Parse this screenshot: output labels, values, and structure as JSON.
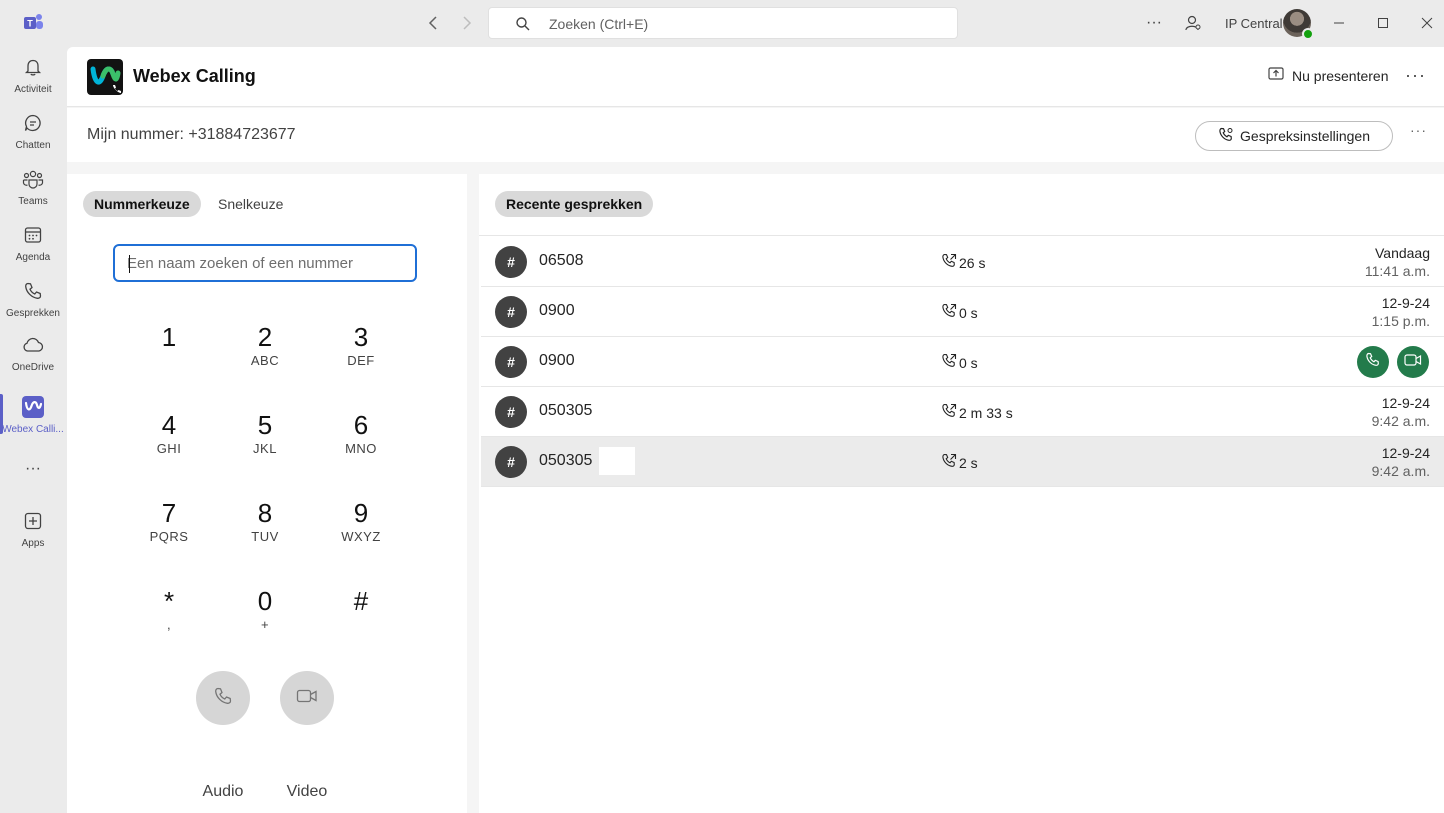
{
  "titlebar": {
    "search_placeholder": "Zoeken (Ctrl+E)",
    "org_name": "IP Central",
    "more": "···"
  },
  "rail": {
    "items": [
      {
        "label": "Activiteit",
        "icon": "bell-icon"
      },
      {
        "label": "Chatten",
        "icon": "chat-icon"
      },
      {
        "label": "Teams",
        "icon": "teams-icon"
      },
      {
        "label": "Agenda",
        "icon": "calendar-icon"
      },
      {
        "label": "Gesprekken",
        "icon": "phone-icon"
      },
      {
        "label": "OneDrive",
        "icon": "cloud-icon"
      },
      {
        "label": "Webex Calli...",
        "icon": "webex-icon",
        "active": true
      },
      {
        "label": "Apps",
        "icon": "add-app-icon"
      }
    ],
    "more": "···"
  },
  "app": {
    "title": "Webex Calling",
    "present_label": "Nu presenteren",
    "more": "···"
  },
  "subbar": {
    "my_number": "Mijn nummer: +31884723677",
    "settings_label": "Gespreksinstellingen",
    "more": "···"
  },
  "dialer": {
    "tabs": [
      "Nummerkeuze",
      "Snelkeuze"
    ],
    "selected_tab": "Nummerkeuze",
    "input_placeholder": "Een naam zoeken of een nummer",
    "keys": [
      {
        "digit": "1",
        "letters": ""
      },
      {
        "digit": "2",
        "letters": "ABC"
      },
      {
        "digit": "3",
        "letters": "DEF"
      },
      {
        "digit": "4",
        "letters": "GHI"
      },
      {
        "digit": "5",
        "letters": "JKL"
      },
      {
        "digit": "6",
        "letters": "MNO"
      },
      {
        "digit": "7",
        "letters": "PQRS"
      },
      {
        "digit": "8",
        "letters": "TUV"
      },
      {
        "digit": "9",
        "letters": "WXYZ"
      },
      {
        "digit": "*",
        "letters": ","
      },
      {
        "digit": "0",
        "letters": "+"
      },
      {
        "digit": "#",
        "letters": ""
      }
    ],
    "audio_label": "Audio",
    "video_label": "Video"
  },
  "recent": {
    "tab_label": "Recente gesprekken",
    "calls": [
      {
        "avatar": "#",
        "number": "06508",
        "duration": "26 s",
        "date": "Vandaag",
        "time": "11:41 a.m."
      },
      {
        "avatar": "#",
        "number": "0900",
        "duration": "0 s",
        "date": "12-9-24",
        "time": "1:15 p.m."
      },
      {
        "avatar": "#",
        "number": "0900",
        "duration": "0 s",
        "date": "",
        "time": "",
        "hover": true
      },
      {
        "avatar": "#",
        "number": "050305",
        "duration": "2 m 33 s",
        "date": "12-9-24",
        "time": "9:42 a.m."
      },
      {
        "avatar": "#",
        "number": "050305",
        "duration": "2 s",
        "date": "12-9-24",
        "time": "9:42 a.m.",
        "highlighted": true
      }
    ]
  },
  "colors": {
    "accent": "#5b5fc7",
    "call_green": "#237b4b",
    "focus_blue": "#1f6fd6"
  }
}
